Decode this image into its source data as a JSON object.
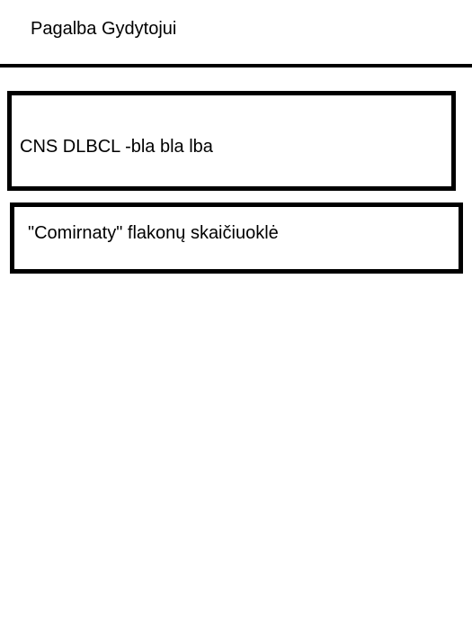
{
  "header": {
    "title": "Pagalba Gydytojui"
  },
  "menu": {
    "items": [
      {
        "label": "CNS DLBCL -bla bla lba"
      },
      {
        "label": "\"Comirnaty\" flakonų skaičiuoklė"
      }
    ]
  },
  "colors": {
    "background": "#ffffff",
    "border": "#000000",
    "text": "#000000"
  }
}
